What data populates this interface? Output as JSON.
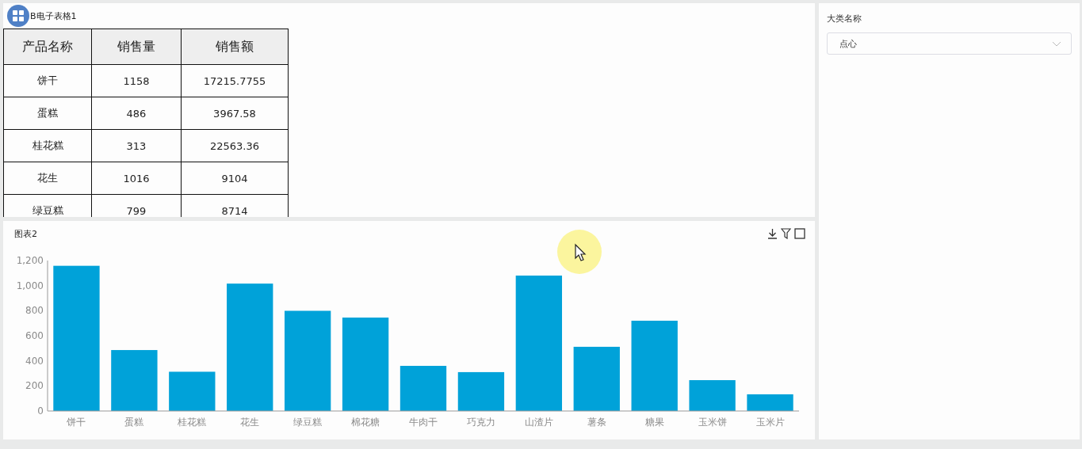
{
  "table_panel": {
    "title": "B电子表格1",
    "columns": [
      "产品名称",
      "销售量",
      "销售额"
    ],
    "rows": [
      [
        "饼干",
        "1158",
        "17215.7755"
      ],
      [
        "蛋糕",
        "486",
        "3967.58"
      ],
      [
        "桂花糕",
        "313",
        "22563.36"
      ],
      [
        "花生",
        "1016",
        "9104"
      ],
      [
        "绿豆糕",
        "799",
        "8714"
      ]
    ]
  },
  "chart_panel": {
    "title": "图表2",
    "chart_data": {
      "type": "bar",
      "categories": [
        "饼干",
        "蛋糕",
        "桂花糕",
        "花生",
        "绿豆糕",
        "棉花糖",
        "牛肉干",
        "巧克力",
        "山渣片",
        "薯条",
        "糖果",
        "玉米饼",
        "玉米片"
      ],
      "series": [
        {
          "color": "#00a2d9",
          "values": [
            1158,
            486,
            313,
            1016,
            799,
            745,
            360,
            310,
            1080,
            512,
            720,
            246,
            133
          ]
        }
      ],
      "ylim": [
        0,
        1200
      ],
      "yticks": [
        0,
        {
          "value": 200,
          "label": "200"
        },
        {
          "value": 400,
          "label": "400"
        },
        {
          "value": 600,
          "label": "600"
        },
        {
          "value": 800,
          "label": "800"
        },
        {
          "value": 1000,
          "label": "1,000"
        },
        {
          "value": 1200,
          "label": "1,200"
        }
      ]
    }
  },
  "filter_panel": {
    "label": "大类名称",
    "select": {
      "value": "点心"
    }
  }
}
